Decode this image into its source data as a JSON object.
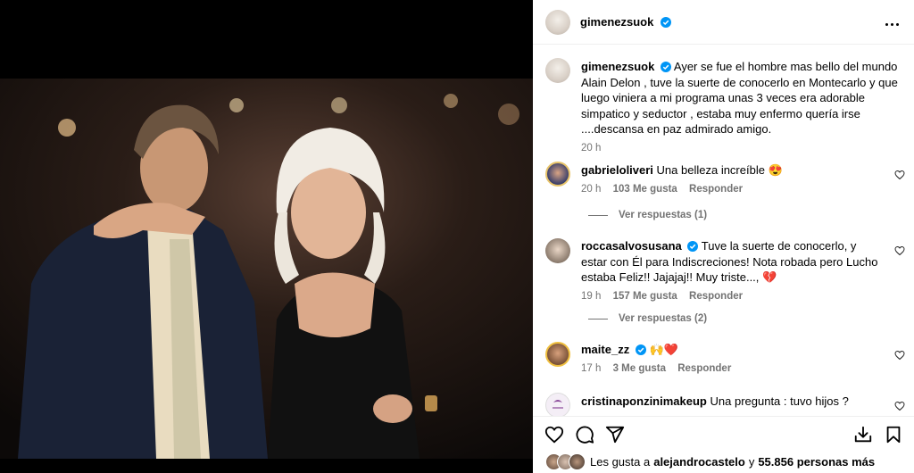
{
  "post": {
    "author": "gimenezsuok",
    "caption": "Ayer se fue el hombre mas bello del mundo Alain Delon , tuve la suerte de conocerlo en Montecarlo y que luego viniera a mi programa unas 3 veces era adorable simpatico y seductor , estaba muy enfermo quería irse ....descansa en paz admirado amigo.",
    "time": "20 h"
  },
  "comments": [
    {
      "user": "gabrieloliveri",
      "text": "Una belleza increíble 😍",
      "time": "20 h",
      "likes": "103 Me gusta",
      "reply": "Responder",
      "view_replies": "Ver respuestas (1)"
    },
    {
      "user": "roccasalvosusana",
      "text": "Tuve la suerte de conocerlo, y estar con Él para Indiscreciones! Nota robada pero Lucho estaba Feliz!! Jajajaj!! Muy triste..., 💔",
      "time": "19 h",
      "likes": "157 Me gusta",
      "reply": "Responder",
      "view_replies": "Ver respuestas (2)"
    },
    {
      "user": "maite_zz",
      "text": "🙌❤️",
      "time": "17 h",
      "likes": "3 Me gusta",
      "reply": "Responder"
    },
    {
      "user": "cristinaponzinimakeup",
      "text": "Una pregunta : tuvo hijos ?"
    }
  ],
  "likes_line": {
    "prefix": "Les gusta a",
    "user": "alejandrocastelo",
    "middle": "y",
    "count": "55.856 personas más"
  },
  "icons": [
    "heart-icon",
    "comment-icon",
    "share-icon",
    "download-icon",
    "bookmark-icon",
    "more-options-icon",
    "verified-badge-icon"
  ],
  "colors": {
    "verified": "#0095f6",
    "secondary_text": "#737373",
    "divider": "#efefef"
  }
}
